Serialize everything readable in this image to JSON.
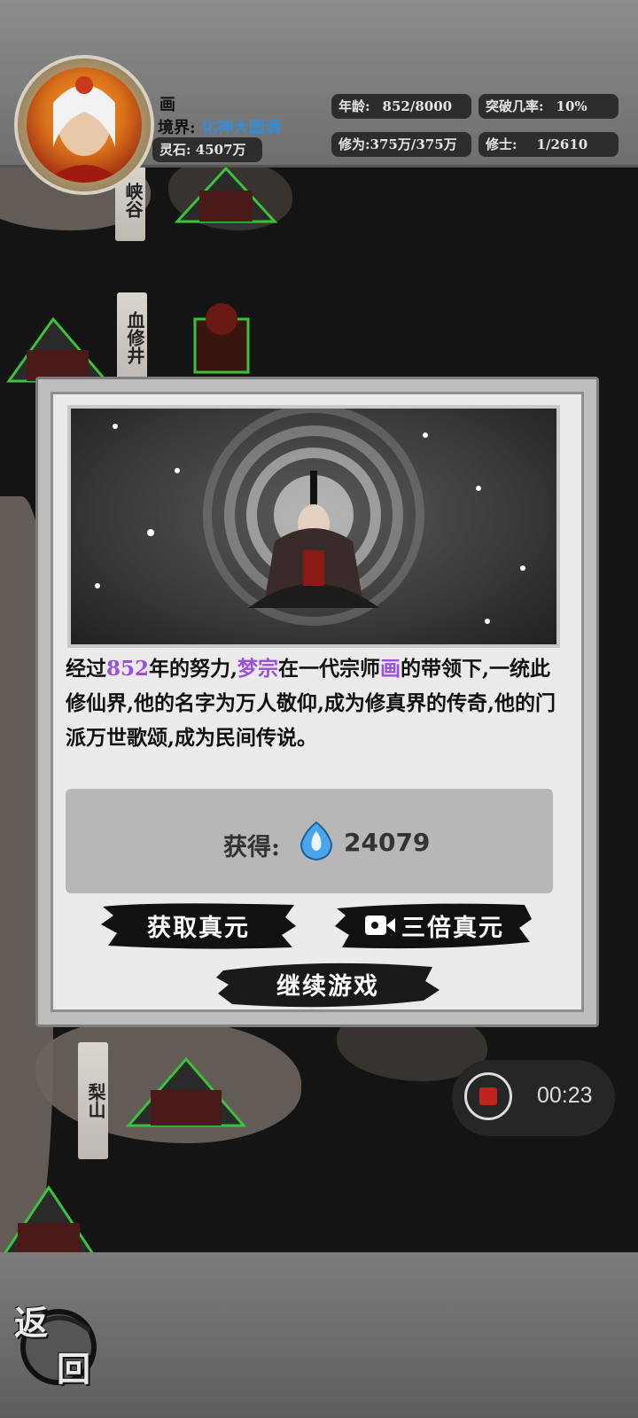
{
  "player": {
    "name": "画",
    "realm_label": "境界:",
    "realm_value": "化神大圆满",
    "spirit_stone": "灵石: 4507万"
  },
  "stats": {
    "age_label": "年龄:",
    "age_value": "852/8000",
    "breakthrough_label": "突破几率:",
    "breakthrough_value": "10%",
    "cultivation": "修为:375万/375万",
    "disciples_label": "修士:",
    "disciples_value": "1/2610"
  },
  "map": {
    "places": [
      "峡谷",
      "血修井",
      "梨山"
    ]
  },
  "dialog": {
    "story_parts": {
      "p1": "经过",
      "years": "852",
      "p2": "年的努力,",
      "sect": "梦宗",
      "p3": "在一代宗师",
      "master": "画",
      "p4": "的带领下,一统此修仙界,他的名字为万人敬仰,成为修真界的传奇,他的门派万世歌颂,成为民间传说。"
    },
    "reward_label": "获得:",
    "reward_value": "24079",
    "reward_icon": "true-essence-crystal-icon",
    "btn_get": "获取真元",
    "btn_triple": "三倍真元",
    "btn_continue": "继续游戏"
  },
  "recorder": {
    "time": "00:23"
  },
  "nav": {
    "back_top": "返",
    "back_bottom": "回"
  },
  "colors": {
    "highlight": "#9b4ee0",
    "realm": "#3a8bd0",
    "record": "#c0241c"
  }
}
